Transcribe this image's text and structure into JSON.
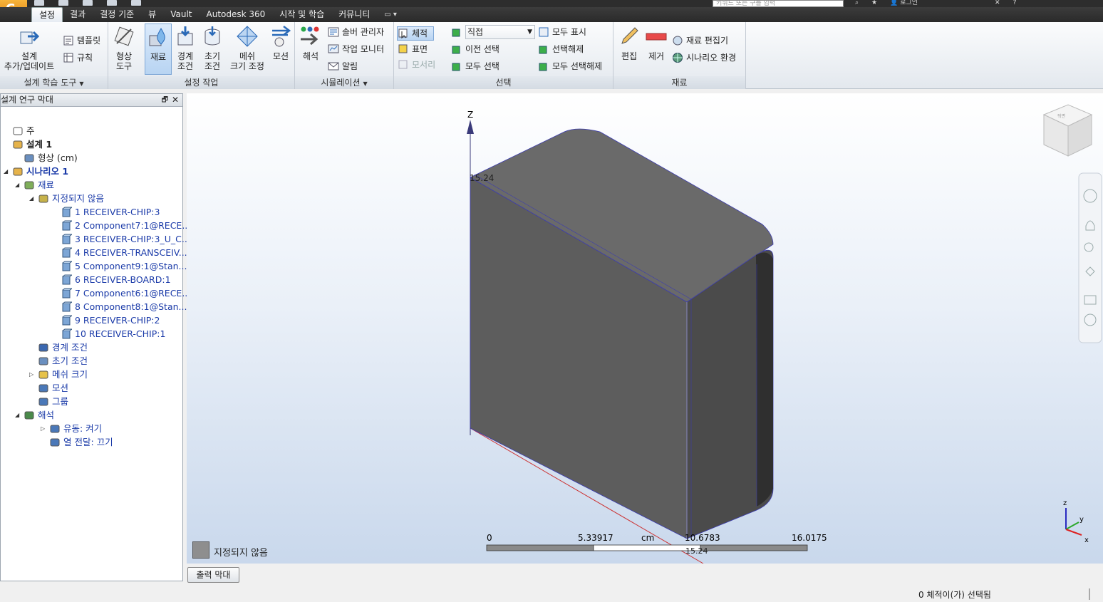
{
  "qat": {
    "icons": [
      "new-icon",
      "open-icon",
      "save-icon",
      "undo-icon",
      "print-icon"
    ]
  },
  "search": {
    "placeholder": "키워드 또는 구를 입력"
  },
  "topright": {
    "login": "로그인"
  },
  "tabs": [
    {
      "label": "설정",
      "active": true
    },
    {
      "label": "결과"
    },
    {
      "label": "결정 기준"
    },
    {
      "label": "뷰"
    },
    {
      "label": "Vault"
    },
    {
      "label": "Autodesk 360"
    },
    {
      "label": "시작 및 학습"
    },
    {
      "label": "커뮤니티"
    }
  ],
  "ribbon": {
    "learn": {
      "title": "설계 학습 도구",
      "update_l1": "설계",
      "update_l2": "추가/업데이트",
      "template": "템플릿",
      "rules": "규칙"
    },
    "setup": {
      "title": "설정 작업",
      "geometry_l1": "형상",
      "geometry_l2": "도구",
      "material": "재료",
      "boundary_l1": "경계",
      "boundary_l2": "조건",
      "initial_l1": "초기",
      "initial_l2": "조건",
      "mesh_l1": "메쉬",
      "mesh_l2": "크기 조정",
      "motion": "모션"
    },
    "simulation": {
      "title": "시뮬레이션",
      "solve": "해석",
      "solver_manager": "솔버 관리자",
      "job_monitor": "작업 모니터",
      "notify": "알림"
    },
    "selection": {
      "title": "선택",
      "volume": "체적",
      "surface": "표면",
      "edge": "모서리",
      "mode": "직접",
      "prev_select": "이전 선택",
      "select_all": "모두 선택",
      "show_all": "모두 표시",
      "deselect": "선택해제",
      "deselect_all": "모두 선택해제"
    },
    "material": {
      "title": "재료",
      "edit": "편집",
      "remove": "제거",
      "material_editor": "재료 편집기",
      "scenario_env": "시나리오 환경"
    }
  },
  "browser": {
    "title": "설계 연구 막대",
    "nodes": [
      {
        "label": "주",
        "level": 0,
        "icon": "note-icon"
      },
      {
        "label": "설계 1",
        "level": 0,
        "icon": "design-icon",
        "bold": true
      },
      {
        "label": "형상 (cm)",
        "level": 1,
        "icon": "geometry-icon"
      },
      {
        "label": "시나리오 1",
        "level": 0,
        "icon": "scenario-icon",
        "bold": true,
        "blue": true,
        "expand": "◢"
      },
      {
        "label": "재료",
        "level": 1,
        "icon": "materials-icon",
        "blue": true,
        "expand": "◢"
      },
      {
        "label": "지정되지 않음",
        "level": 2,
        "icon": "unassigned-icon",
        "blue": true,
        "expand": "◢"
      },
      {
        "label": "1 RECEIVER-CHIP:3",
        "level": 4,
        "icon": "part-icon",
        "blue": true
      },
      {
        "label": "2 Component7:1@RECE...",
        "level": 4,
        "icon": "part-icon",
        "blue": true
      },
      {
        "label": "3 RECEIVER-CHIP:3_U_C...",
        "level": 4,
        "icon": "part-icon",
        "blue": true
      },
      {
        "label": "4 RECEIVER-TRANSCEIV...",
        "level": 4,
        "icon": "part-icon",
        "blue": true
      },
      {
        "label": "5 Component9:1@Stan...",
        "level": 4,
        "icon": "part-icon",
        "blue": true
      },
      {
        "label": "6 RECEIVER-BOARD:1",
        "level": 4,
        "icon": "part-icon",
        "blue": true
      },
      {
        "label": "7 Component6:1@RECE...",
        "level": 4,
        "icon": "part-icon",
        "blue": true
      },
      {
        "label": "8 Component8:1@Stan...",
        "level": 4,
        "icon": "part-icon",
        "blue": true
      },
      {
        "label": "9 RECEIVER-CHIP:2",
        "level": 4,
        "icon": "part-icon",
        "blue": true
      },
      {
        "label": "10 RECEIVER-CHIP:1",
        "level": 4,
        "icon": "part-icon",
        "blue": true
      },
      {
        "label": "경계 조건",
        "level": 2,
        "icon": "boundary-icon",
        "blue": true
      },
      {
        "label": "초기 조건",
        "level": 2,
        "icon": "initial-icon",
        "blue": true
      },
      {
        "label": "메쉬 크기",
        "level": 2,
        "icon": "mesh-icon",
        "blue": true,
        "expand": "▷"
      },
      {
        "label": "모션",
        "level": 2,
        "icon": "motion-icon",
        "blue": true
      },
      {
        "label": "그룹",
        "level": 2,
        "icon": "group-icon",
        "blue": true
      },
      {
        "label": "해석",
        "level": 1,
        "icon": "solve-icon",
        "blue": true,
        "expand": "◢"
      },
      {
        "label": "유동: 켜기",
        "level": 3,
        "icon": "flow-icon",
        "blue": true,
        "expand": "▷"
      },
      {
        "label": "열 전달: 끄기",
        "level": 3,
        "icon": "heat-icon",
        "blue": true
      }
    ]
  },
  "viewport": {
    "axis_z": "Z",
    "dim_label": "15.24",
    "dim_label_bottom": "15.24",
    "ruler": {
      "t0": "0",
      "t1": "5.33917",
      "unit": "cm",
      "t2": "10.6783",
      "t3": "16.0175"
    },
    "legend": {
      "label": "지정되지 않음",
      "color": "#8e8e8e"
    },
    "triad": {
      "z": "z",
      "y": "y",
      "x": "x"
    },
    "viewcube_face": "뒤면"
  },
  "bottom": {
    "output_bar": "출력 막대",
    "status": "0 체적이(가) 선택됨"
  }
}
